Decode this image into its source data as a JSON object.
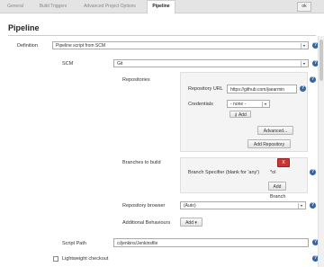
{
  "tabs": [
    {
      "label": "General"
    },
    {
      "label": "Build Triggers"
    },
    {
      "label": "Advanced Project Options"
    },
    {
      "label": "Pipeline"
    }
  ],
  "tabbar_right": "ok",
  "section_title": "Pipeline",
  "definition": {
    "label": "Definition",
    "value": "Pipeline script from SCM"
  },
  "scm": {
    "label": "SCM",
    "value": "Git"
  },
  "repositories": {
    "label": "Repositories",
    "repo_url_label": "Repository URL",
    "repo_url_value": "https://github.com/jaearmin",
    "credentials_label": "Credentials",
    "credentials_value": "- none -",
    "add_button": "Add",
    "advanced_button": "Advanced...",
    "add_repository_button": "Add Repository"
  },
  "branches": {
    "label": "Branches to build",
    "specifier_label": "Branch Specifier (blank for 'any')",
    "specifier_value": "*ol",
    "add_button": "Add",
    "add_branch_text": "Branch",
    "delete_button": "X"
  },
  "repository_browser": {
    "label": "Repository browser",
    "value": "(Auto)"
  },
  "additional_behaviours": {
    "label": "Additional Behaviours",
    "button": "Add"
  },
  "script_path": {
    "label": "Script Path",
    "value": "ci/jenkins/Jenkinsfile"
  },
  "lightweight_checkout": {
    "label": "Lightweight checkout"
  },
  "help_glyph": "?",
  "colors": {
    "help_icon": "#3465a4",
    "delete_button": "#cc3333",
    "tab_bar": "#e4e4e4"
  }
}
